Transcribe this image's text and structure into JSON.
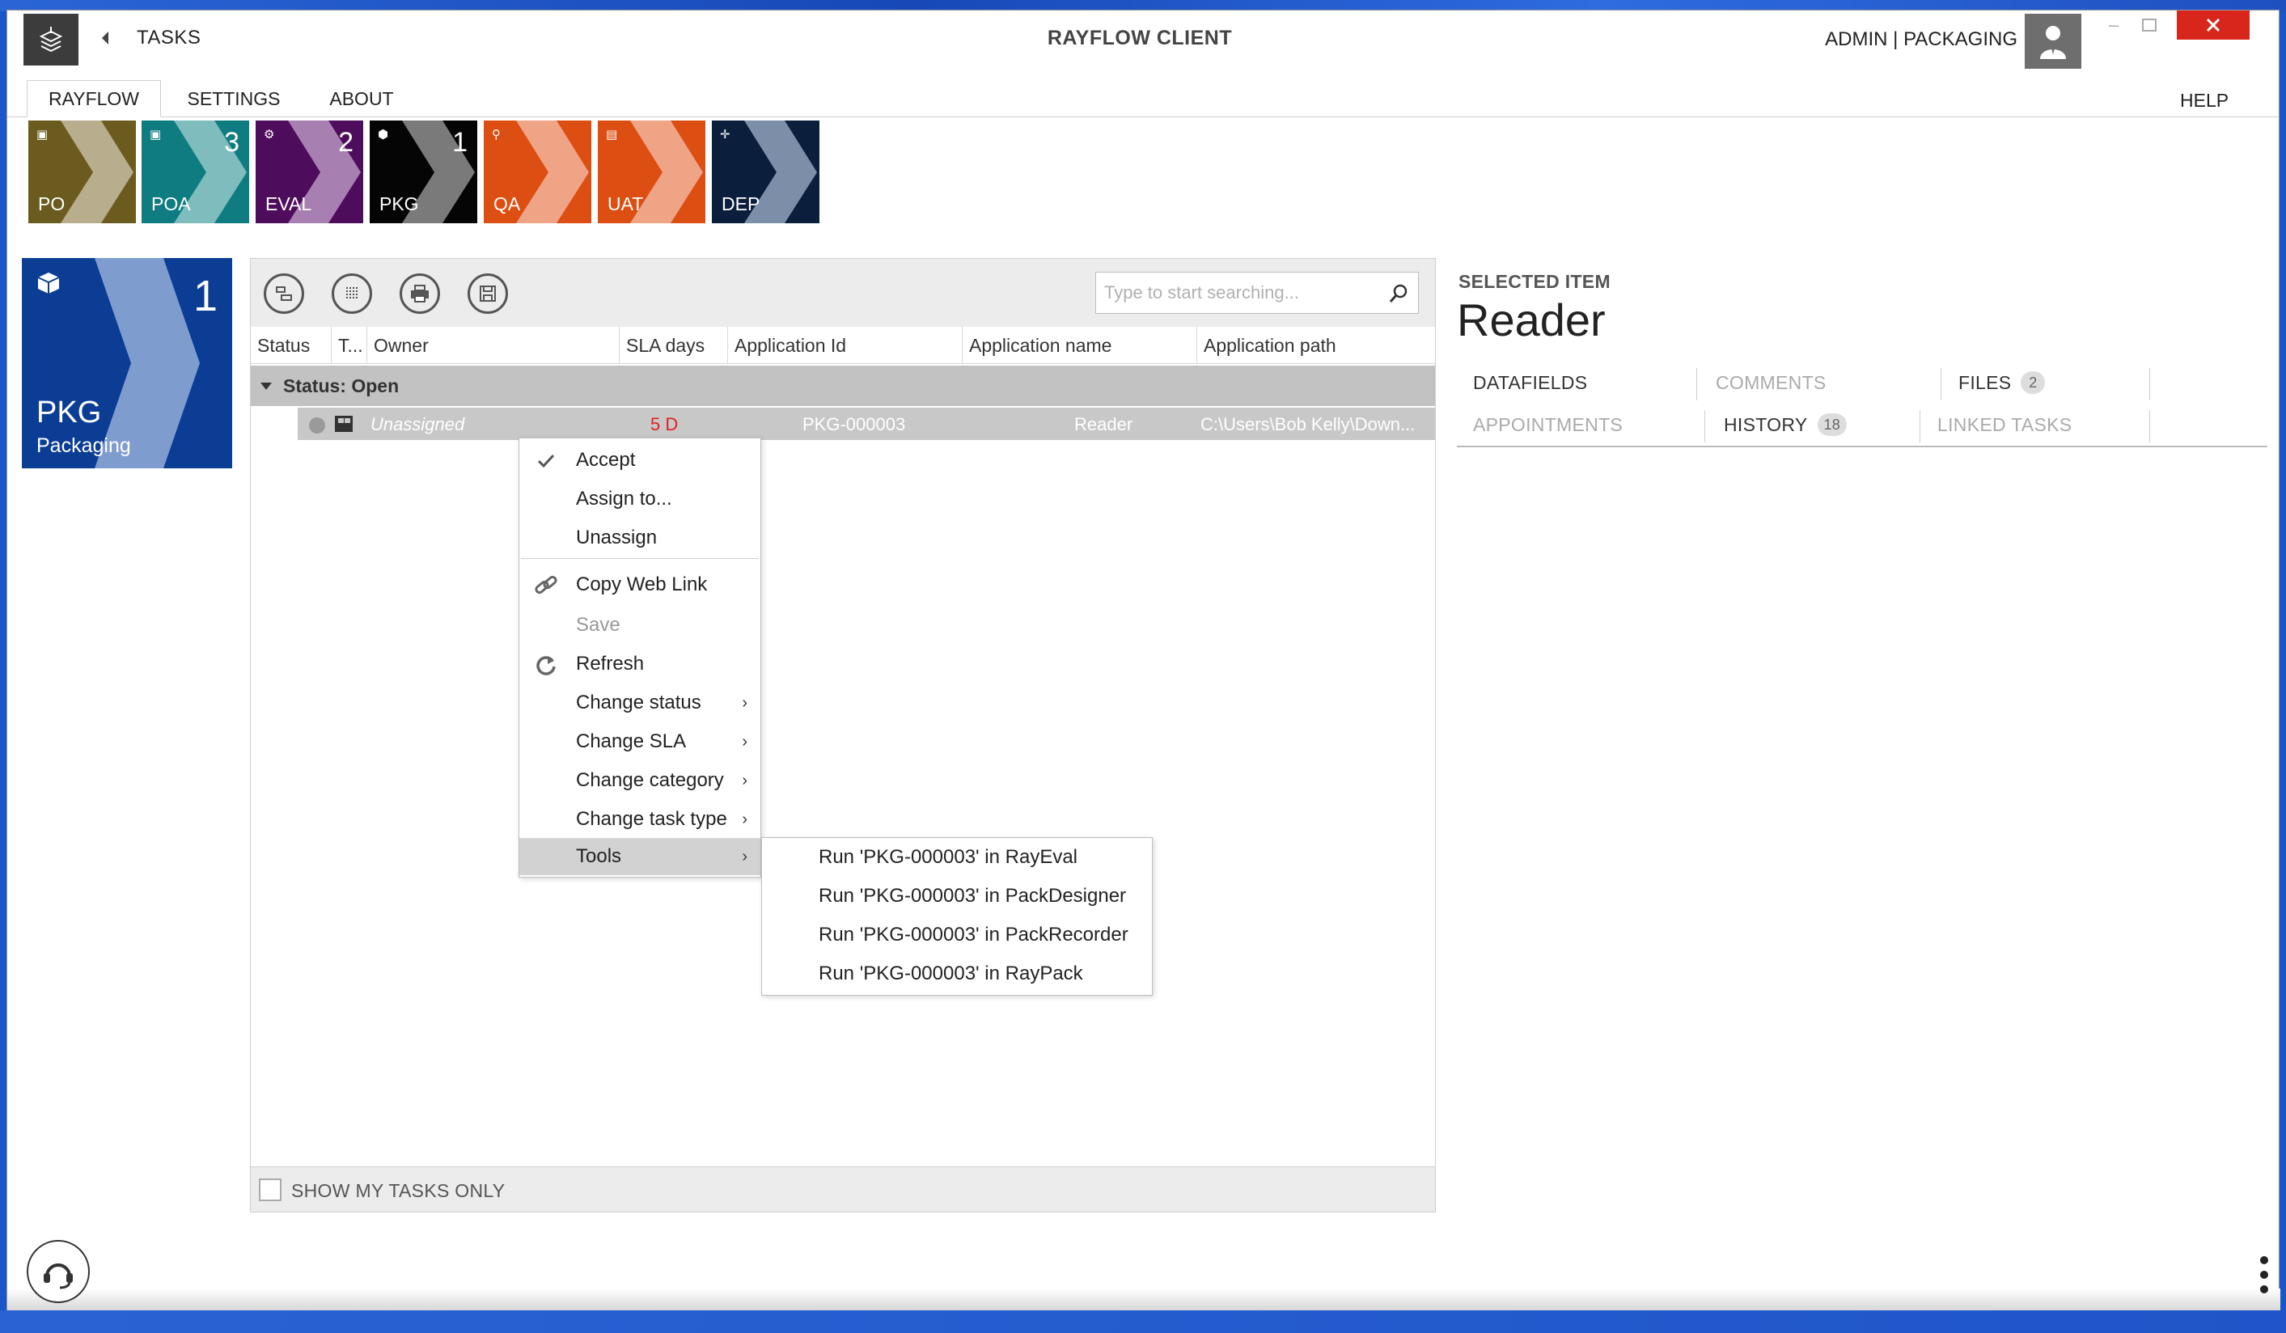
{
  "window": {
    "app_title": "RAYFLOW CLIENT",
    "section": "TASKS",
    "user": "ADMIN | PACKAGING"
  },
  "menu": {
    "tabs": [
      "RAYFLOW",
      "SETTINGS",
      "ABOUT"
    ],
    "help": "HELP"
  },
  "workflow_tiles": [
    {
      "code": "PO",
      "count": "",
      "color": "#6b5b1e",
      "chev": "#b8ad8c"
    },
    {
      "code": "POA",
      "count": "3",
      "color": "#0e7c80",
      "chev": "#7fbcbe"
    },
    {
      "code": "EVAL",
      "count": "2",
      "color": "#4e0d5c",
      "chev": "#a77fb0"
    },
    {
      "code": "PKG",
      "count": "1",
      "color": "#050505",
      "chev": "#7a7a7a"
    },
    {
      "code": "QA",
      "count": "",
      "color": "#dd4e12",
      "chev": "#f0a486"
    },
    {
      "code": "UAT",
      "count": "",
      "color": "#dd4e12",
      "chev": "#f0a486"
    },
    {
      "code": "DEP",
      "count": "",
      "color": "#0b1f3d",
      "chev": "#7d8ea8"
    }
  ],
  "selected_tile": {
    "code": "PKG",
    "name": "Packaging",
    "count": "1",
    "color": "#0b3d94"
  },
  "search": {
    "placeholder": "Type to start searching..."
  },
  "columns": [
    "Status",
    "T...",
    "Owner",
    "SLA days",
    "Application Id",
    "Application name",
    "Application path"
  ],
  "group": {
    "label": "Status: Open"
  },
  "task": {
    "owner": "Unassigned",
    "sla": "5 D",
    "application_id": "PKG-000003",
    "application_name": "Reader",
    "application_path": "C:\\Users\\Bob Kelly\\Down..."
  },
  "footer": {
    "show_my_tasks": "SHOW MY TASKS ONLY"
  },
  "detail": {
    "caption": "SELECTED ITEM",
    "title": "Reader",
    "tabs": {
      "datafields": "DATAFIELDS",
      "comments": "COMMENTS",
      "files": "FILES",
      "files_count": "2",
      "appointments": "APPOINTMENTS",
      "history": "HISTORY",
      "history_count": "18",
      "linked_tasks": "LINKED TASKS"
    }
  },
  "context_menu": {
    "accept": "Accept",
    "assign_to": "Assign to...",
    "unassign": "Unassign",
    "copy_web_link": "Copy Web Link",
    "save": "Save",
    "refresh": "Refresh",
    "change_status": "Change status",
    "change_sla": "Change SLA",
    "change_category": "Change category",
    "change_task_type": "Change task type",
    "tools": "Tools"
  },
  "tools_submenu": [
    "Run 'PKG-000003' in RayEval",
    "Run 'PKG-000003' in PackDesigner",
    "Run 'PKG-000003' in PackRecorder",
    "Run 'PKG-000003' in RayPack"
  ]
}
